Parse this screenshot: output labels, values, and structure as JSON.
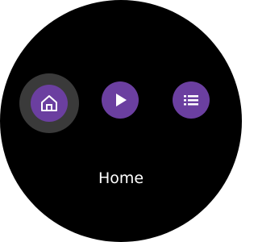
{
  "screen": {
    "selected_label": "Home"
  },
  "nav": {
    "items": [
      {
        "icon": "home-icon",
        "selected": true
      },
      {
        "icon": "play-icon",
        "selected": false
      },
      {
        "icon": "list-icon",
        "selected": false
      }
    ]
  },
  "colors": {
    "background": "#000000",
    "button": "#6b3fa0",
    "highlight": "#3a3a3a",
    "text": "#ffffff"
  }
}
